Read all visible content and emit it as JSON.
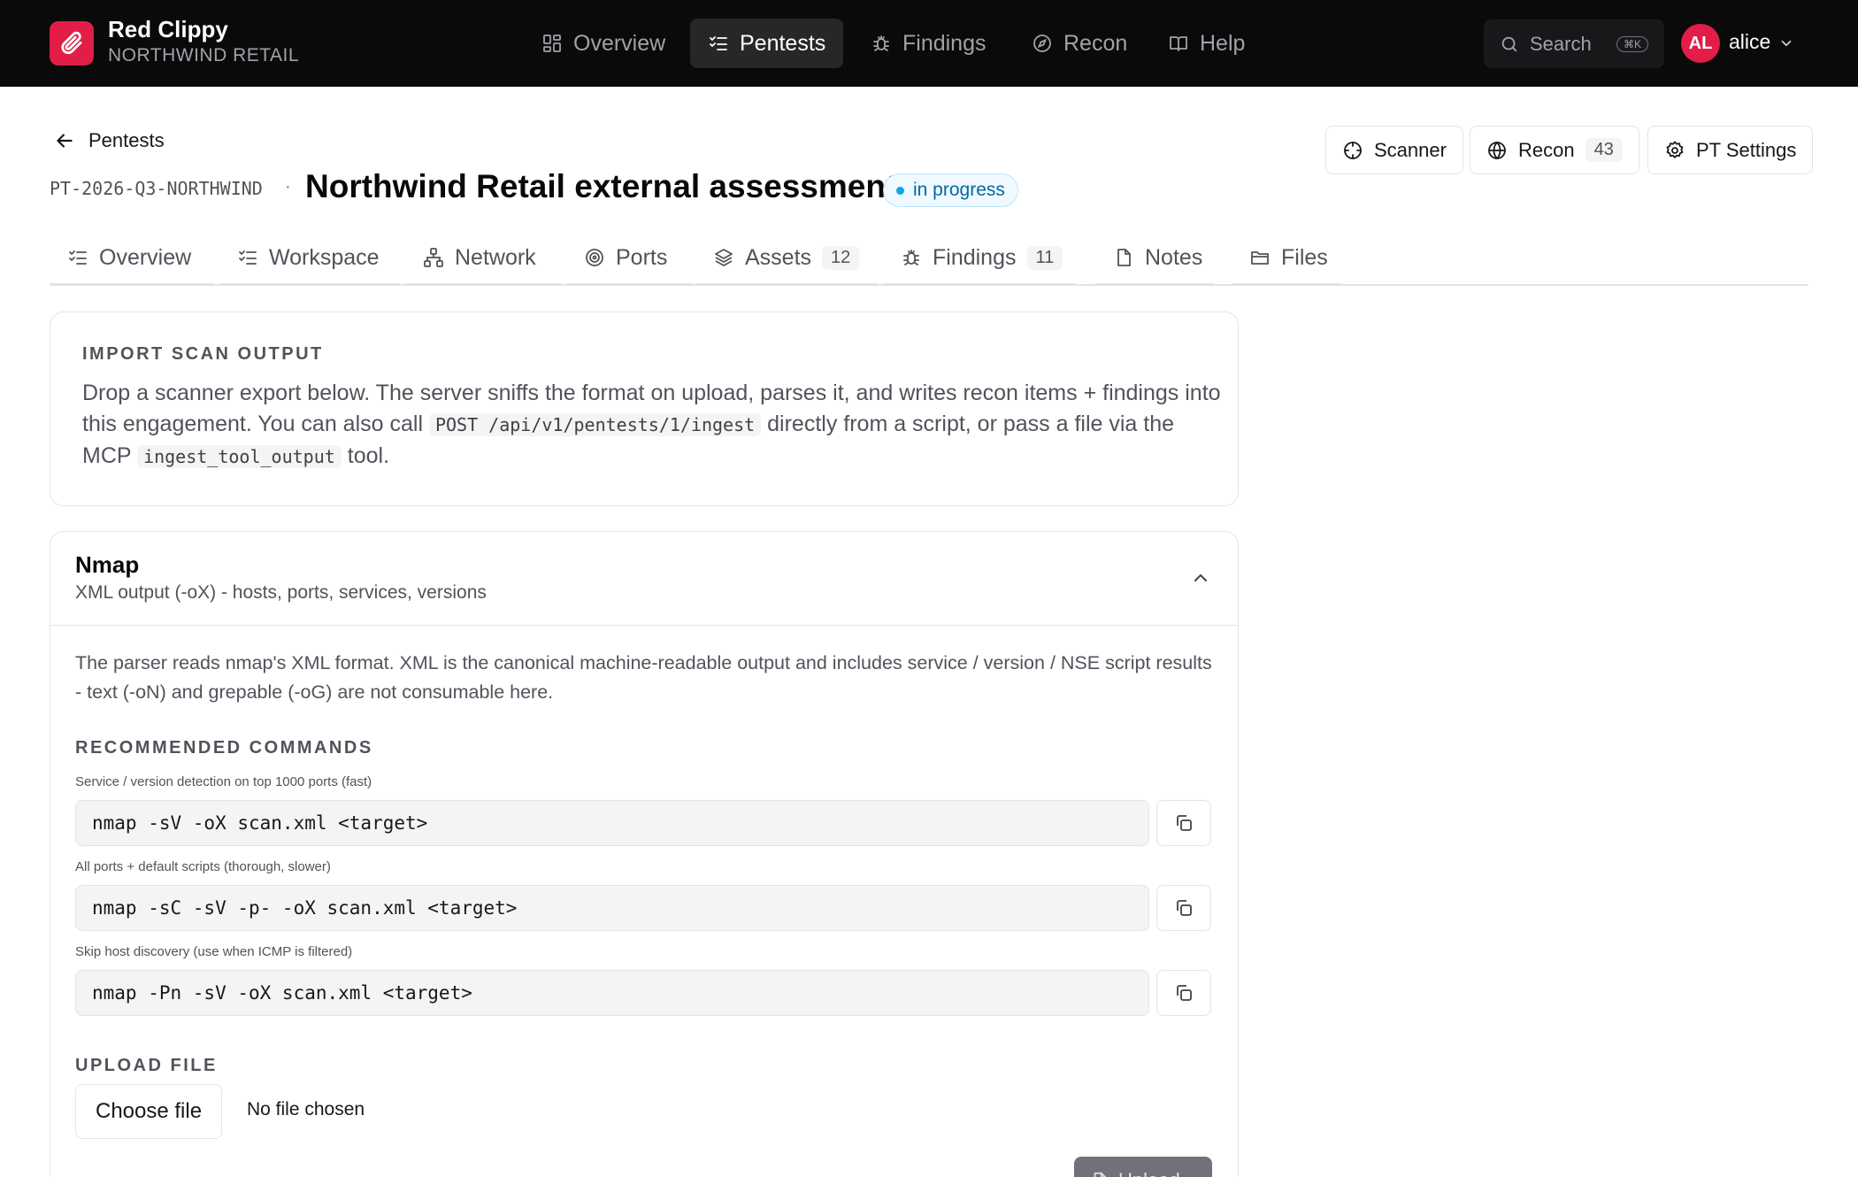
{
  "app": {
    "name": "Red Clippy",
    "org": "NORTHWIND RETAIL"
  },
  "nav": {
    "items": [
      {
        "label": "Overview",
        "icon": "grid-icon"
      },
      {
        "label": "Pentests",
        "icon": "checklist-icon",
        "active": true
      },
      {
        "label": "Findings",
        "icon": "bug-icon"
      },
      {
        "label": "Recon",
        "icon": "compass-icon"
      },
      {
        "label": "Help",
        "icon": "book-icon"
      }
    ],
    "search_label": "Search",
    "search_shortcut": "⌘K"
  },
  "user": {
    "initials": "AL",
    "name": "alice"
  },
  "header": {
    "back_label": "Pentests",
    "pentest_id": "PT-2026-Q3-NORTHWIND",
    "separator": "·",
    "title": "Northwind Retail external assessment",
    "status": "in progress",
    "buttons": {
      "scanner": "Scanner",
      "recon": "Recon",
      "recon_count": "43",
      "settings": "PT Settings"
    }
  },
  "tabs": [
    {
      "label": "Overview",
      "icon": "checklist-icon",
      "count": ""
    },
    {
      "label": "Workspace",
      "icon": "checklist-icon",
      "count": ""
    },
    {
      "label": "Network",
      "icon": "network-icon",
      "count": ""
    },
    {
      "label": "Ports",
      "icon": "radar-icon",
      "count": ""
    },
    {
      "label": "Assets",
      "icon": "layers-icon",
      "count": "12"
    },
    {
      "label": "Findings",
      "icon": "bug-icon",
      "count": "11"
    },
    {
      "label": "Notes",
      "icon": "file-icon",
      "count": ""
    },
    {
      "label": "Files",
      "icon": "folder-icon",
      "count": ""
    }
  ],
  "import": {
    "title": "IMPORT SCAN OUTPUT",
    "desc_1": "Drop a scanner export below. The server sniffs the format on upload, parses it, and writes recon items + findings into this engagement. You can also call ",
    "desc_code_1": "POST /api/v1/pentests/1/ingest",
    "desc_2": " directly from a script, or pass a file via the MCP ",
    "desc_code_2": "ingest_tool_output",
    "desc_3": " tool."
  },
  "nmap": {
    "title": "Nmap",
    "subtitle": "XML output (-oX) - hosts, ports, services, versions",
    "parser_desc": "The parser reads nmap's XML format. XML is the canonical machine-readable output and includes service / version / NSE script results - text (-oN) and grepable (-oG) are not consumable here.",
    "recommended_title": "RECOMMENDED COMMANDS",
    "commands": [
      {
        "label": "Service / version detection on top 1000 ports (fast)",
        "cmd": "nmap -sV -oX scan.xml <target>"
      },
      {
        "label": "All ports + default scripts (thorough, slower)",
        "cmd": "nmap -sC -sV -p- -oX scan.xml <target>"
      },
      {
        "label": "Skip host discovery (use when ICMP is filtered)",
        "cmd": "nmap -Pn -sV -oX scan.xml <target>"
      }
    ],
    "upload_title": "UPLOAD FILE",
    "choose_file": "Choose file",
    "no_file": "No file chosen",
    "upload_button": "Upload"
  },
  "colors": {
    "brand": "#e11d48",
    "topbar": "#0a0a0a",
    "status": "#0369a1"
  }
}
